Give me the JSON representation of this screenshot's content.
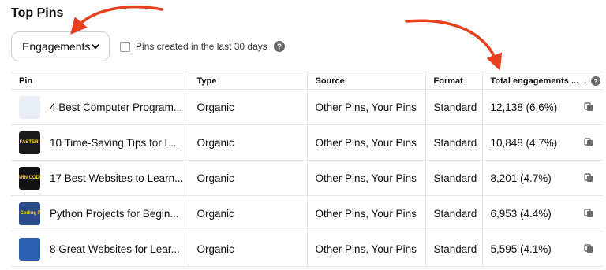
{
  "title": "Top Pins",
  "metric_dropdown": {
    "selected": "Engagements"
  },
  "filter": {
    "label": "Pins created in the last 30 days",
    "checked": false
  },
  "table": {
    "columns": [
      "Pin",
      "Type",
      "Source",
      "Format",
      "Total engagements ..."
    ],
    "sort_arrow": "↓",
    "rows": [
      {
        "pin": "4 Best Computer Program...",
        "type": "Organic",
        "source": "Other Pins, Your Pins",
        "format": "Standard",
        "engagements": "12,138 (6.6%)",
        "thumb_color": "#e8eef4",
        "thumb_text": ""
      },
      {
        "pin": "10 Time-Saving Tips for L...",
        "type": "Organic",
        "source": "Other Pins, Your Pins",
        "format": "Standard",
        "engagements": "10,848 (4.7%)",
        "thumb_color": "#1a1a1a",
        "thumb_text": "FASTER!"
      },
      {
        "pin": "17 Best Websites to Learn...",
        "type": "Organic",
        "source": "Other Pins, Your Pins",
        "format": "Standard",
        "engagements": "8,201 (4.7%)",
        "thumb_color": "#111111",
        "thumb_text": "LEARN CODING"
      },
      {
        "pin": "Python Projects for Begin...",
        "type": "Organic",
        "source": "Other Pins, Your Pins",
        "format": "Standard",
        "engagements": "6,953 (4.4%)",
        "thumb_color": "#2b4a8a",
        "thumb_text": "Python Coding Projects"
      },
      {
        "pin": "8 Great Websites for Lear...",
        "type": "Organic",
        "source": "Other Pins, Your Pins",
        "format": "Standard",
        "engagements": "5,595 (4.1%)",
        "thumb_color": "#2d5fb0",
        "thumb_text": ""
      }
    ]
  },
  "colors": {
    "annotation_arrow": "#e8401f",
    "border": "#e6e6e6"
  },
  "icons": {
    "dropdown": "chevron-down-icon",
    "help": "help-circle-icon",
    "copy": "copy-icon",
    "sort": "arrow-down-icon"
  }
}
